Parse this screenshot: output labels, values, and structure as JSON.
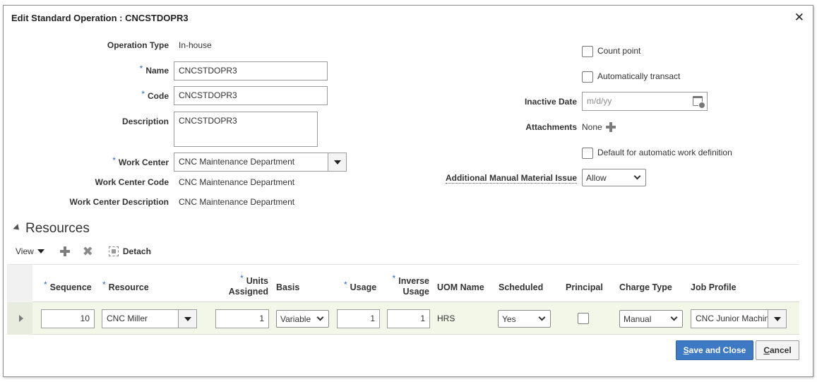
{
  "dialog": {
    "title": "Edit Standard Operation : CNCSTDOPR3",
    "close_glyph": "✕"
  },
  "form": {
    "operation_type_label": "Operation Type",
    "operation_type_value": "In-house",
    "name_label": "Name",
    "name_value": "CNCSTDOPR3",
    "code_label": "Code",
    "code_value": "CNCSTDOPR3",
    "description_label": "Description",
    "description_value": "CNCSTDOPR3",
    "work_center_label": "Work Center",
    "work_center_value": "CNC Maintenance Department",
    "work_center_code_label": "Work Center Code",
    "work_center_code_value": "CNC Maintenance Department",
    "work_center_description_label": "Work Center Description",
    "work_center_description_value": "CNC Maintenance Department",
    "required_mark": "*"
  },
  "right_form": {
    "count_point_label": "Count point",
    "auto_transact_label": "Automatically transact",
    "inactive_date_label": "Inactive Date",
    "inactive_date_placeholder": "m/d/yy",
    "attachments_label": "Attachments",
    "attachments_value": "None",
    "default_work_def_label": "Default for automatic work definition",
    "additional_issue_label": "Additional Manual Material Issue",
    "additional_issue_value": "Allow"
  },
  "resources": {
    "section_title": "Resources",
    "toolbar": {
      "view_label": "View",
      "detach_label": "Detach"
    },
    "columns": {
      "sequence": "Sequence",
      "resource": "Resource",
      "units_line1": "Units",
      "units_line2": "Assigned",
      "basis": "Basis",
      "usage": "Usage",
      "inverse_line1": "Inverse",
      "inverse_line2": "Usage",
      "uom": "UOM Name",
      "scheduled": "Scheduled",
      "principal": "Principal",
      "charge_type": "Charge Type",
      "job_profile": "Job Profile"
    },
    "rows": [
      {
        "sequence": "10",
        "resource": "CNC Miller",
        "units": "1",
        "basis": "Variable",
        "usage": "1",
        "inverse": "1",
        "uom": "HRS",
        "scheduled": "Yes",
        "charge_type": "Manual",
        "job_profile": "CNC Junior Machin"
      }
    ]
  },
  "buttons": {
    "save_close": "Save and Close",
    "cancel": "Cancel"
  },
  "colors": {
    "primary": "#3e79c4",
    "row_highlight": "#f2f7e8",
    "required": "#2f6bb3"
  }
}
